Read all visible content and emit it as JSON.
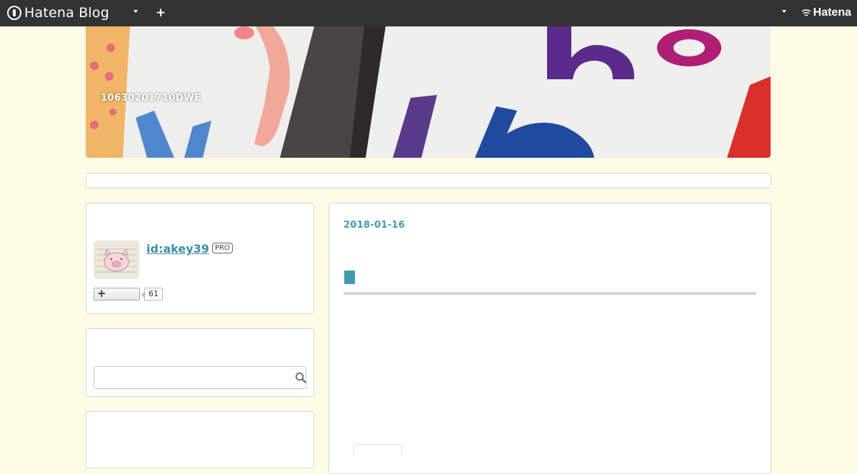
{
  "topbar": {
    "logo_text": "Hatena Blog",
    "plus_label": "+",
    "brand_text": "Hatena",
    "background": "#333333"
  },
  "header": {
    "blog_title": "10630201710DWE"
  },
  "profile": {
    "user_id": "id:akey39",
    "badge": "PRO",
    "follow_label": "+",
    "follow_count": "61"
  },
  "search": {
    "value": "",
    "placeholder": "",
    "icon": "search-icon"
  },
  "article": {
    "date": "2018-01-16"
  },
  "colors": {
    "page_bg": "#fffce6",
    "accent": "#3f9bb4",
    "link": "#3f8ea6"
  }
}
